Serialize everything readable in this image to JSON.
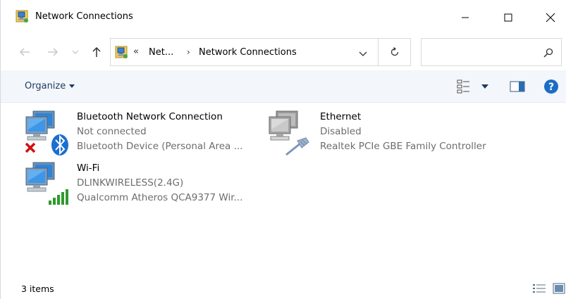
{
  "window": {
    "title": "Network Connections",
    "icon": "network-connections-icon"
  },
  "address": {
    "overflow": "«",
    "segment1": "Net...",
    "separator": "›",
    "segment2": "Network Connections"
  },
  "search": {
    "placeholder": ""
  },
  "toolbar": {
    "organize_label": "Organize"
  },
  "items": [
    {
      "name": "Bluetooth Network Connection",
      "status": "Not connected",
      "device": "Bluetooth Device (Personal Area ...",
      "icon": "bluetooth-network-icon"
    },
    {
      "name": "Ethernet",
      "status": "Disabled",
      "device": "Realtek PCIe GBE Family Controller",
      "icon": "ethernet-icon"
    },
    {
      "name": "Wi-Fi",
      "status": "DLINKWIRELESS(2.4G)",
      "device": "Qualcomm Atheros QCA9377 Wir...",
      "icon": "wifi-network-icon"
    }
  ],
  "statusbar": {
    "count": "3 items"
  },
  "colors": {
    "accent": "#1c6ec4",
    "commandbar": "#f3f6fb",
    "muted_text": "#6d6d6d"
  }
}
